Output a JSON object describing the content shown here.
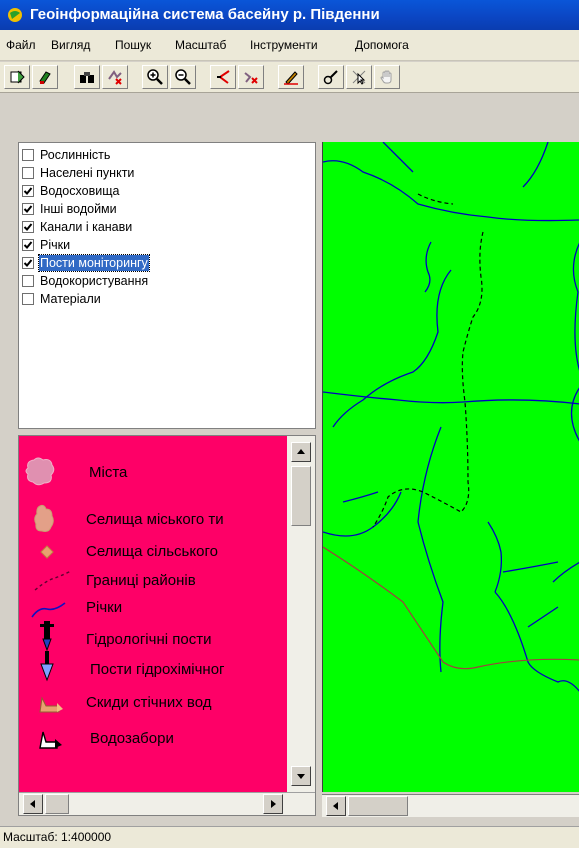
{
  "window": {
    "title": "Геоінформаційна система басейну р. Південни"
  },
  "menu": {
    "items": [
      "Файл",
      "Вигляд",
      "Пошук",
      "Масштаб",
      "Інструменти",
      "Допомога"
    ]
  },
  "toolbar": {
    "icons": [
      "add-layer-icon",
      "remove-layer-icon",
      "binoculars-icon",
      "select-feature-icon",
      "zoom-in-icon",
      "zoom-out-icon",
      "measure-icon",
      "clear-selection-icon",
      "edit-icon",
      "info-icon",
      "pointer-select-icon",
      "pan-hand-icon"
    ]
  },
  "layers": {
    "items": [
      {
        "label": "Рослинність",
        "checked": false
      },
      {
        "label": "Населені пункти",
        "checked": false
      },
      {
        "label": "Водосховища",
        "checked": true
      },
      {
        "label": "Інші водойми",
        "checked": true
      },
      {
        "label": "Канали і канави",
        "checked": true
      },
      {
        "label": "Річки",
        "checked": true
      },
      {
        "label": "Пости моніторингу",
        "checked": true,
        "selected": true
      },
      {
        "label": "Водокористування",
        "checked": false
      },
      {
        "label": "Матеріали",
        "checked": false
      }
    ]
  },
  "legend": {
    "background": "#fe0067",
    "items": [
      {
        "label": "Міста",
        "symbol": "city-area-icon"
      },
      {
        "label": "Селища міського ти",
        "symbol": "town-area-icon"
      },
      {
        "label": "Селища сільського",
        "symbol": "village-point-icon"
      },
      {
        "label": "Границі районів",
        "symbol": "district-border-icon"
      },
      {
        "label": "Річки",
        "symbol": "river-line-icon"
      },
      {
        "label": "Гідрологічні пости",
        "symbol": "hydrological-post-icon"
      },
      {
        "label": "Пости гідрохімічног",
        "symbol": "hydrochemical-post-icon"
      },
      {
        "label": "Скиди стічних вод",
        "symbol": "wastewater-discharge-icon"
      },
      {
        "label": "Водозабори",
        "symbol": "water-intake-icon"
      }
    ]
  },
  "map": {
    "background": "#00ff00",
    "river_color": "#0000c0",
    "border_color": "#a04040"
  },
  "status": {
    "scale_text": "Масштаб: 1:400000"
  }
}
